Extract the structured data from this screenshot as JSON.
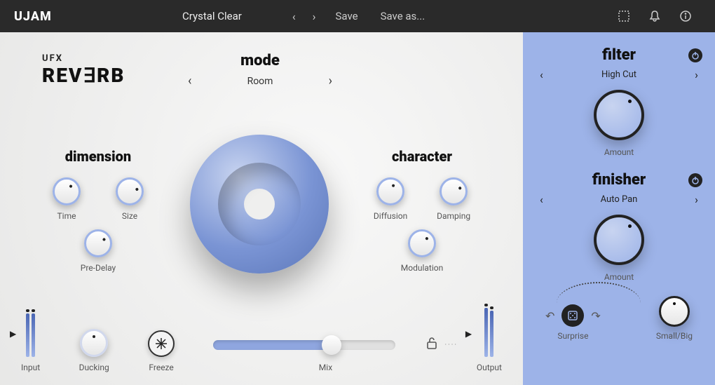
{
  "header": {
    "brand": "UJAM",
    "preset_name": "Crystal Clear",
    "save_label": "Save",
    "save_as_label": "Save as..."
  },
  "logo": {
    "line1": "UFX",
    "line2": "REVERB"
  },
  "mode": {
    "title": "mode",
    "value": "Room"
  },
  "dimension": {
    "title": "dimension",
    "knobs": [
      {
        "label": "Time"
      },
      {
        "label": "Size"
      },
      {
        "label": "Pre-Delay"
      }
    ]
  },
  "character": {
    "title": "character",
    "knobs": [
      {
        "label": "Diffusion"
      },
      {
        "label": "Damping"
      },
      {
        "label": "Modulation"
      }
    ]
  },
  "bottom": {
    "input_label": "Input",
    "ducking_label": "Ducking",
    "freeze_label": "Freeze",
    "mix_label": "Mix",
    "output_label": "Output"
  },
  "filter": {
    "title": "filter",
    "value": "High Cut",
    "amount_label": "Amount"
  },
  "finisher": {
    "title": "finisher",
    "value": "Auto Pan",
    "amount_label": "Amount"
  },
  "surprise_label": "Surprise",
  "smallbig_label": "Small/Big"
}
